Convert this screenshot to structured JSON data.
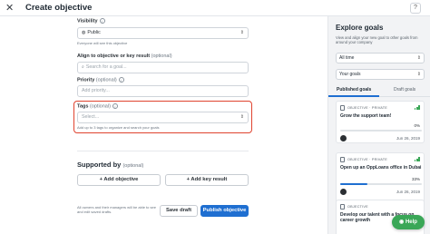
{
  "header": {
    "close_glyph": "✕",
    "title": "Create objective",
    "help_glyph": "?"
  },
  "form": {
    "visibility": {
      "label": "Visibility",
      "value": "Public",
      "hint": "Everyone will see this objective"
    },
    "align": {
      "label": "Align to objective or key result",
      "optional": "(optional)",
      "placeholder": "Search for a goal..."
    },
    "priority": {
      "label": "Priority",
      "optional": "(optional)",
      "placeholder": "Add priority..."
    },
    "tags": {
      "label": "Tags",
      "optional": "(optional)",
      "placeholder": "Select...",
      "hint": "Add up to 3 tags to organize and search your goals"
    },
    "supported_by": {
      "label": "Supported by",
      "optional": "(optional)"
    },
    "add_objective_label": "Add objective",
    "add_key_result_label": "Add key result",
    "footnote": "All owners and their managers will be able to see and edit saved drafts.",
    "save_draft_label": "Save draft",
    "publish_label": "Publish objective"
  },
  "sidebar": {
    "title": "Explore goals",
    "description": "View and align your new goal to other goals from around your company",
    "filter_time": "All time",
    "filter_goals": "Your goals",
    "tabs": [
      "Published goals",
      "Draft goals"
    ],
    "cards": [
      {
        "type": "OBJECTIVE · PRIVATE",
        "title": "Grow the support team!",
        "progress_pct": 0,
        "progress_label": "0%",
        "date": "Jun 26, 2019"
      },
      {
        "type": "OBJECTIVE · PRIVATE",
        "title": "Open up an OppLoans office in Dubai",
        "progress_pct": 33,
        "progress_label": "33%",
        "date": "Jun 26, 2019"
      },
      {
        "type": "OBJECTIVE",
        "title": "Develop our talent with a focus on career growth",
        "progress_pct": 0,
        "progress_label": "",
        "date": ""
      }
    ]
  },
  "help_button_label": "Help",
  "colors": {
    "accent": "#1f6fd1",
    "highlight": "#e0432f",
    "help": "#3aa757"
  }
}
